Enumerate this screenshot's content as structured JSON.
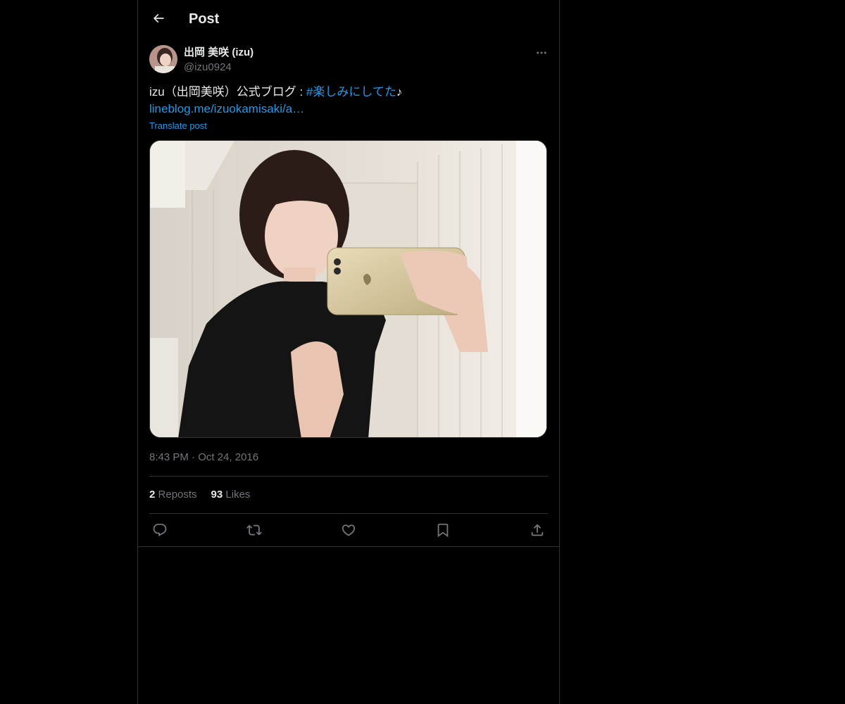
{
  "header": {
    "title": "Post"
  },
  "author": {
    "display_name": "出岡 美咲 (izu)",
    "handle": "@izu0924"
  },
  "post": {
    "text_prefix": "izu（出岡美咲）公式ブログ : ",
    "hashtag": "#楽しみにしてた",
    "text_suffix": "♪",
    "link": "lineblog.me/izuokamisaki/a…",
    "translate_label": "Translate post",
    "time": "8:43 PM",
    "separator": "·",
    "date": "Oct 24, 2016"
  },
  "stats": {
    "reposts_count": "2",
    "reposts_label": "Reposts",
    "likes_count": "93",
    "likes_label": "Likes"
  },
  "icons": {
    "back": "arrow-left-icon",
    "more": "more-horizontal-icon",
    "reply": "reply-icon",
    "repost": "repost-icon",
    "like": "heart-icon",
    "bookmark": "bookmark-icon",
    "share": "share-icon"
  },
  "colors": {
    "background": "#000000",
    "text": "#e7e9ea",
    "muted": "#71767b",
    "accent": "#1d9bf0",
    "border": "#2f3336"
  }
}
